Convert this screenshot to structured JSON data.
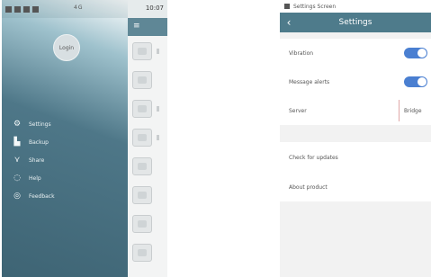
{
  "left_screen": {
    "status_bar": {
      "time": "10:07",
      "mid_text": "4G"
    },
    "drawer": {
      "login_label": "Login",
      "items": [
        {
          "label": "Settings",
          "icon": "gear-icon"
        },
        {
          "label": "Backup",
          "icon": "file-icon"
        },
        {
          "label": "Share",
          "icon": "share-icon"
        },
        {
          "label": "Help",
          "icon": "help-icon"
        },
        {
          "label": "Feedback",
          "icon": "feedback-icon"
        }
      ]
    },
    "hamburger_icon": "menu-icon"
  },
  "right_screen": {
    "status_bar": {
      "text": "Settings Screen"
    },
    "title_bar": {
      "back_icon": "back-arrow-icon",
      "title": "Settings"
    },
    "rows": {
      "vibration": {
        "label": "Vibration",
        "on": true
      },
      "message_alerts": {
        "label": "Message alerts",
        "on": true
      },
      "server": {
        "label": "Server",
        "value": "Bridge"
      },
      "check_updates": {
        "label": "Check for updates"
      },
      "about": {
        "label": "About product"
      }
    }
  },
  "colors": {
    "header": "#4e7b8b",
    "toggle_on": "#4a7fd1",
    "drawer_dark": "#3e6474"
  }
}
